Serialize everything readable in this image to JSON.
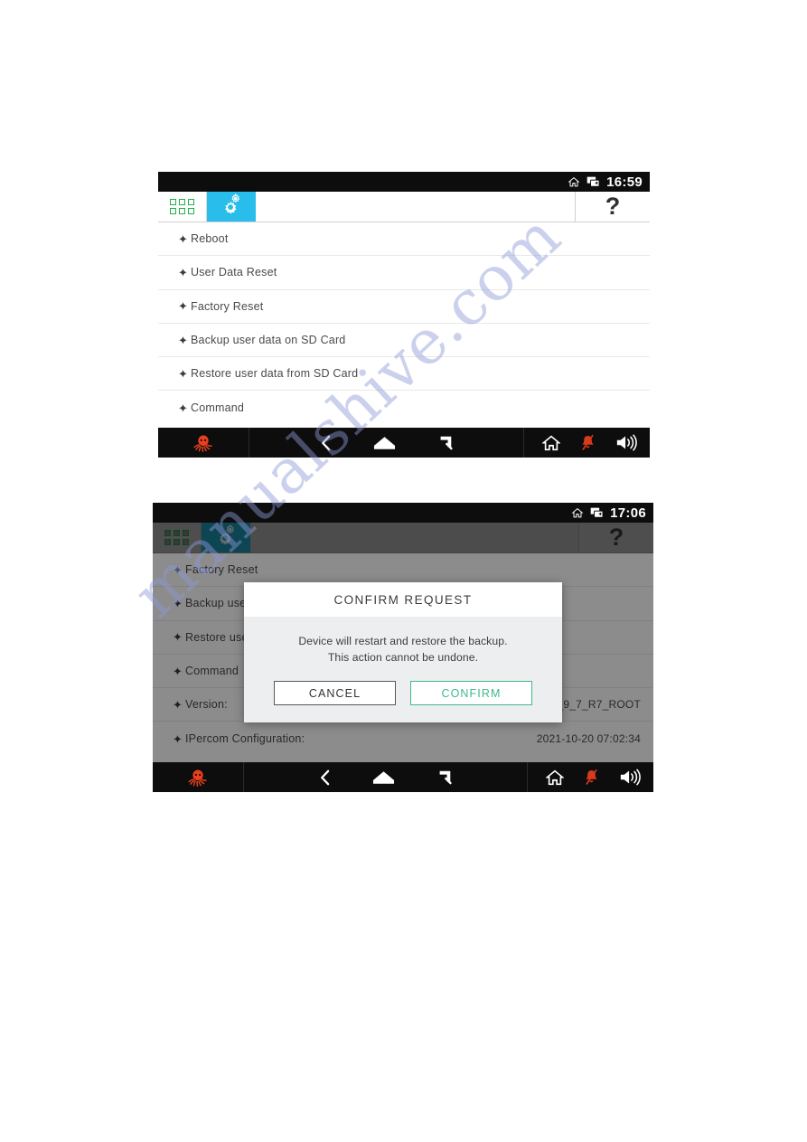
{
  "watermark": {
    "text": "manualshive.com",
    "color": "#8e9ad8"
  },
  "colors": {
    "tab_active": "#29bdec",
    "tab_active_dimmed": "#1a7b96",
    "grid_icon_green": "#23b14d",
    "navbar": "#0d0d0d",
    "statusbar": "#0d0d0d",
    "logo_red": "#e8401f",
    "mute_red": "#d93a1c",
    "confirm_green": "#3fb98a"
  },
  "screens": [
    {
      "id": "settings-list",
      "statusbar": {
        "home_icon": "home-icon",
        "cast_icon": "cast-screen-icon",
        "clock": "16:59"
      },
      "tabs": {
        "apps_tab": "apps-grid-icon",
        "settings_tab": "gear-icon",
        "help_label": "?"
      },
      "rows": [
        {
          "label": "Reboot",
          "value": ""
        },
        {
          "label": "User Data Reset",
          "value": ""
        },
        {
          "label": "Factory Reset",
          "value": ""
        },
        {
          "label": "Backup user data on SD Card",
          "value": ""
        },
        {
          "label": "Restore user data from SD Card",
          "value": ""
        },
        {
          "label": "Command",
          "value": ""
        }
      ],
      "navbar": {
        "logo": "octopus-logo-icon",
        "back": "back-chevron-icon",
        "home": "home-pentagon-icon",
        "recents": "recent-apps-icon",
        "house": "house-outline-icon",
        "mute": "bell-muted-icon",
        "volume": "speaker-volume-icon"
      }
    },
    {
      "id": "settings-list-confirm",
      "statusbar": {
        "home_icon": "home-icon",
        "cast_icon": "cast-screen-icon",
        "clock": "17:06"
      },
      "tabs": {
        "apps_tab": "apps-grid-icon",
        "settings_tab": "gear-icon",
        "help_label": "?"
      },
      "rows": [
        {
          "label": "Factory Reset",
          "value": ""
        },
        {
          "label": "Backup user data on SD Card",
          "value": ""
        },
        {
          "label": "Restore user data from SD Card",
          "value": ""
        },
        {
          "label": "Command",
          "value": ""
        },
        {
          "label": "Version:",
          "value": "21.0_60_VER_7_9_7_R7_ROOT"
        },
        {
          "label": "IPercom Configuration:",
          "value": "2021-10-20 07:02:34"
        }
      ],
      "dialog": {
        "title": "CONFIRM REQUEST",
        "message_line1": "Device will restart and restore the backup.",
        "message_line2": "This action cannot be undone.",
        "cancel_label": "CANCEL",
        "confirm_label": "CONFIRM"
      },
      "navbar": {
        "logo": "octopus-logo-icon",
        "back": "back-chevron-icon",
        "home": "home-pentagon-icon",
        "recents": "recent-apps-icon",
        "house": "house-outline-icon",
        "mute": "bell-muted-icon",
        "volume": "speaker-volume-icon"
      }
    }
  ]
}
